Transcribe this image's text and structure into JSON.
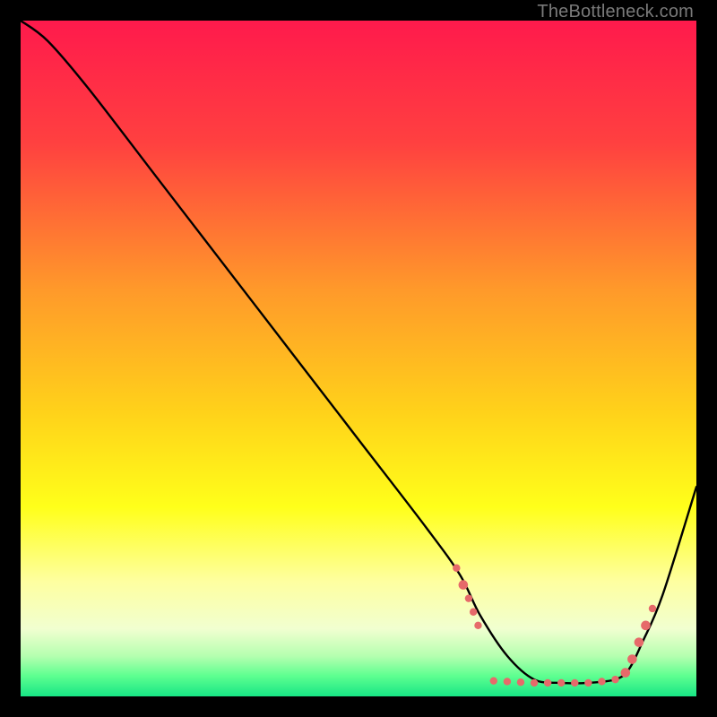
{
  "attribution": "TheBottleneck.com",
  "chart_data": {
    "type": "line",
    "title": "",
    "xlabel": "",
    "ylabel": "",
    "xlim": [
      0,
      100
    ],
    "ylim": [
      0,
      100
    ],
    "background_gradient_stops": [
      {
        "offset": 0,
        "color": "#ff1a4c"
      },
      {
        "offset": 18,
        "color": "#ff4040"
      },
      {
        "offset": 40,
        "color": "#ff9a2a"
      },
      {
        "offset": 58,
        "color": "#ffd21a"
      },
      {
        "offset": 72,
        "color": "#ffff1a"
      },
      {
        "offset": 83,
        "color": "#feffa0"
      },
      {
        "offset": 90,
        "color": "#f1ffd0"
      },
      {
        "offset": 94,
        "color": "#b6ffb0"
      },
      {
        "offset": 97,
        "color": "#5dff90"
      },
      {
        "offset": 100,
        "color": "#17e585"
      }
    ],
    "series": [
      {
        "name": "bottleneck-curve",
        "x": [
          0,
          4,
          10,
          20,
          30,
          40,
          50,
          60,
          65,
          68,
          72,
          76,
          80,
          84,
          88,
          90,
          92,
          95,
          100
        ],
        "y": [
          100,
          97,
          90,
          77,
          64,
          51,
          38,
          25,
          18,
          12,
          6,
          2.5,
          2.0,
          2.0,
          2.5,
          4,
          8,
          15,
          31
        ]
      }
    ],
    "markers": {
      "name": "highlight-dots",
      "color": "#e66a6a",
      "radius_small": 4.2,
      "radius_large": 5.3,
      "points": [
        {
          "x": 64.5,
          "y": 19.0,
          "r": "s"
        },
        {
          "x": 65.5,
          "y": 16.5,
          "r": "l"
        },
        {
          "x": 66.3,
          "y": 14.5,
          "r": "s"
        },
        {
          "x": 67.0,
          "y": 12.5,
          "r": "s"
        },
        {
          "x": 67.7,
          "y": 10.5,
          "r": "s"
        },
        {
          "x": 70.0,
          "y": 2.3,
          "r": "s"
        },
        {
          "x": 72.0,
          "y": 2.2,
          "r": "s"
        },
        {
          "x": 74.0,
          "y": 2.1,
          "r": "s"
        },
        {
          "x": 76.0,
          "y": 2.0,
          "r": "s"
        },
        {
          "x": 78.0,
          "y": 2.0,
          "r": "s"
        },
        {
          "x": 80.0,
          "y": 2.0,
          "r": "s"
        },
        {
          "x": 82.0,
          "y": 2.0,
          "r": "s"
        },
        {
          "x": 84.0,
          "y": 2.0,
          "r": "s"
        },
        {
          "x": 86.0,
          "y": 2.2,
          "r": "s"
        },
        {
          "x": 88.0,
          "y": 2.5,
          "r": "s"
        },
        {
          "x": 89.5,
          "y": 3.5,
          "r": "l"
        },
        {
          "x": 90.5,
          "y": 5.5,
          "r": "l"
        },
        {
          "x": 91.5,
          "y": 8.0,
          "r": "l"
        },
        {
          "x": 92.5,
          "y": 10.5,
          "r": "l"
        },
        {
          "x": 93.5,
          "y": 13.0,
          "r": "s"
        }
      ]
    }
  }
}
